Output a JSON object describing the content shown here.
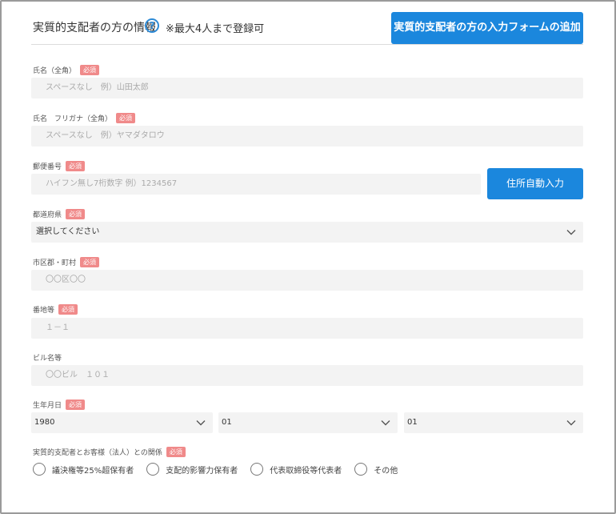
{
  "header": {
    "title": "実質的支配者の方の情報",
    "help_icon": "question-circle-icon",
    "note": "※最大4人まで登録可",
    "add_button_label": "実質的支配者の方の入力フォームの追加"
  },
  "required_label": "必須",
  "fields": {
    "name": {
      "label": "氏名（全角）",
      "placeholder": "スペースなし　例）山田太郎"
    },
    "kana": {
      "label": "氏名　フリガナ（全角）",
      "placeholder": "スペースなし　例）ヤマダタロウ"
    },
    "zip": {
      "label": "郵便番号",
      "placeholder": "ハイフン無し7桁数字 例）1234567",
      "button_label": "住所自動入力"
    },
    "prefecture": {
      "label": "都道府県",
      "selected": "選択してください"
    },
    "city": {
      "label": "市区郡・町村",
      "value": "〇〇区〇〇"
    },
    "address": {
      "label": "番地等",
      "value": "１－１"
    },
    "building": {
      "label": "ビル名等",
      "value": "〇〇ビル　１０１"
    },
    "birth": {
      "label": "生年月日",
      "year": "1980",
      "month": "01",
      "day": "01"
    },
    "relation": {
      "label": "実質的支配者とお客様（法人）との関係",
      "options": [
        "議決権等25%超保有者",
        "支配的影響力保有者",
        "代表取締役等代表者",
        "その他"
      ]
    }
  },
  "colors": {
    "accent": "#1b87dd",
    "required_badge": "#f08a8a",
    "input_bg": "#f3f3f3"
  }
}
